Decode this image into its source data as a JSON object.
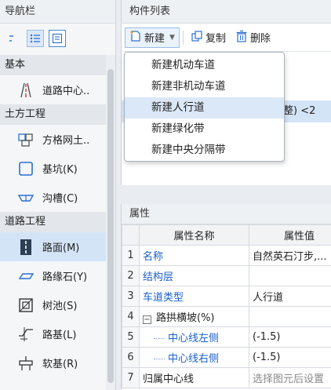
{
  "nav": {
    "title": "导航栏",
    "groups": [
      {
        "label": "基本",
        "items": [
          {
            "label": "道路中心..",
            "icon": "road-centerline-icon"
          }
        ]
      },
      {
        "label": "土方工程",
        "items": [
          {
            "label": "方格网土..",
            "icon": "grid-earthwork-icon"
          },
          {
            "label": "基坑(K)",
            "icon": "foundation-pit-icon"
          },
          {
            "label": "沟槽(C)",
            "icon": "trench-icon"
          }
        ]
      },
      {
        "label": "道路工程",
        "items": [
          {
            "label": "路面(M)",
            "icon": "pavement-icon",
            "selected": true
          },
          {
            "label": "路缘石(Y)",
            "icon": "curbstone-icon"
          },
          {
            "label": "树池(S)",
            "icon": "tree-pit-icon"
          },
          {
            "label": "路基(L)",
            "icon": "subgrade-icon"
          },
          {
            "label": "软基(R)",
            "icon": "soft-foundation-icon"
          }
        ]
      }
    ]
  },
  "component_list": {
    "title": "构件列表",
    "toolbar": {
      "new_label": "新建",
      "copy_label": "复制",
      "delete_label": "删除"
    },
    "rows": [
      {
        "text": "面平整) <2"
      },
      {
        "text": ","
      }
    ]
  },
  "new_menu": {
    "items": [
      {
        "label": "新建机动车道"
      },
      {
        "label": "新建非机动车道"
      },
      {
        "label": "新建人行道",
        "hover": true
      },
      {
        "label": "新建绿化带"
      },
      {
        "label": "新建中央分隔带"
      }
    ]
  },
  "properties": {
    "title": "属性",
    "columns": {
      "name": "属性名称",
      "value": "属性值"
    },
    "rows": [
      {
        "idx": "1",
        "name": "名称",
        "value": "自然英石汀步,..."
      },
      {
        "idx": "2",
        "name": "结构层",
        "value": ""
      },
      {
        "idx": "3",
        "name": "车道类型",
        "value": "人行道"
      },
      {
        "idx": "4",
        "name": "路拱横坡(%)",
        "value": ""
      },
      {
        "idx": "5",
        "name": "中心线左侧",
        "value": "(-1.5)"
      },
      {
        "idx": "6",
        "name": "中心线右侧",
        "value": "(-1.5)"
      },
      {
        "idx": "7",
        "name": "归属中心线",
        "value": "选择图元后设置"
      }
    ]
  },
  "colors": {
    "accent": "#1a5fc8",
    "selection": "#d4e4f7"
  }
}
